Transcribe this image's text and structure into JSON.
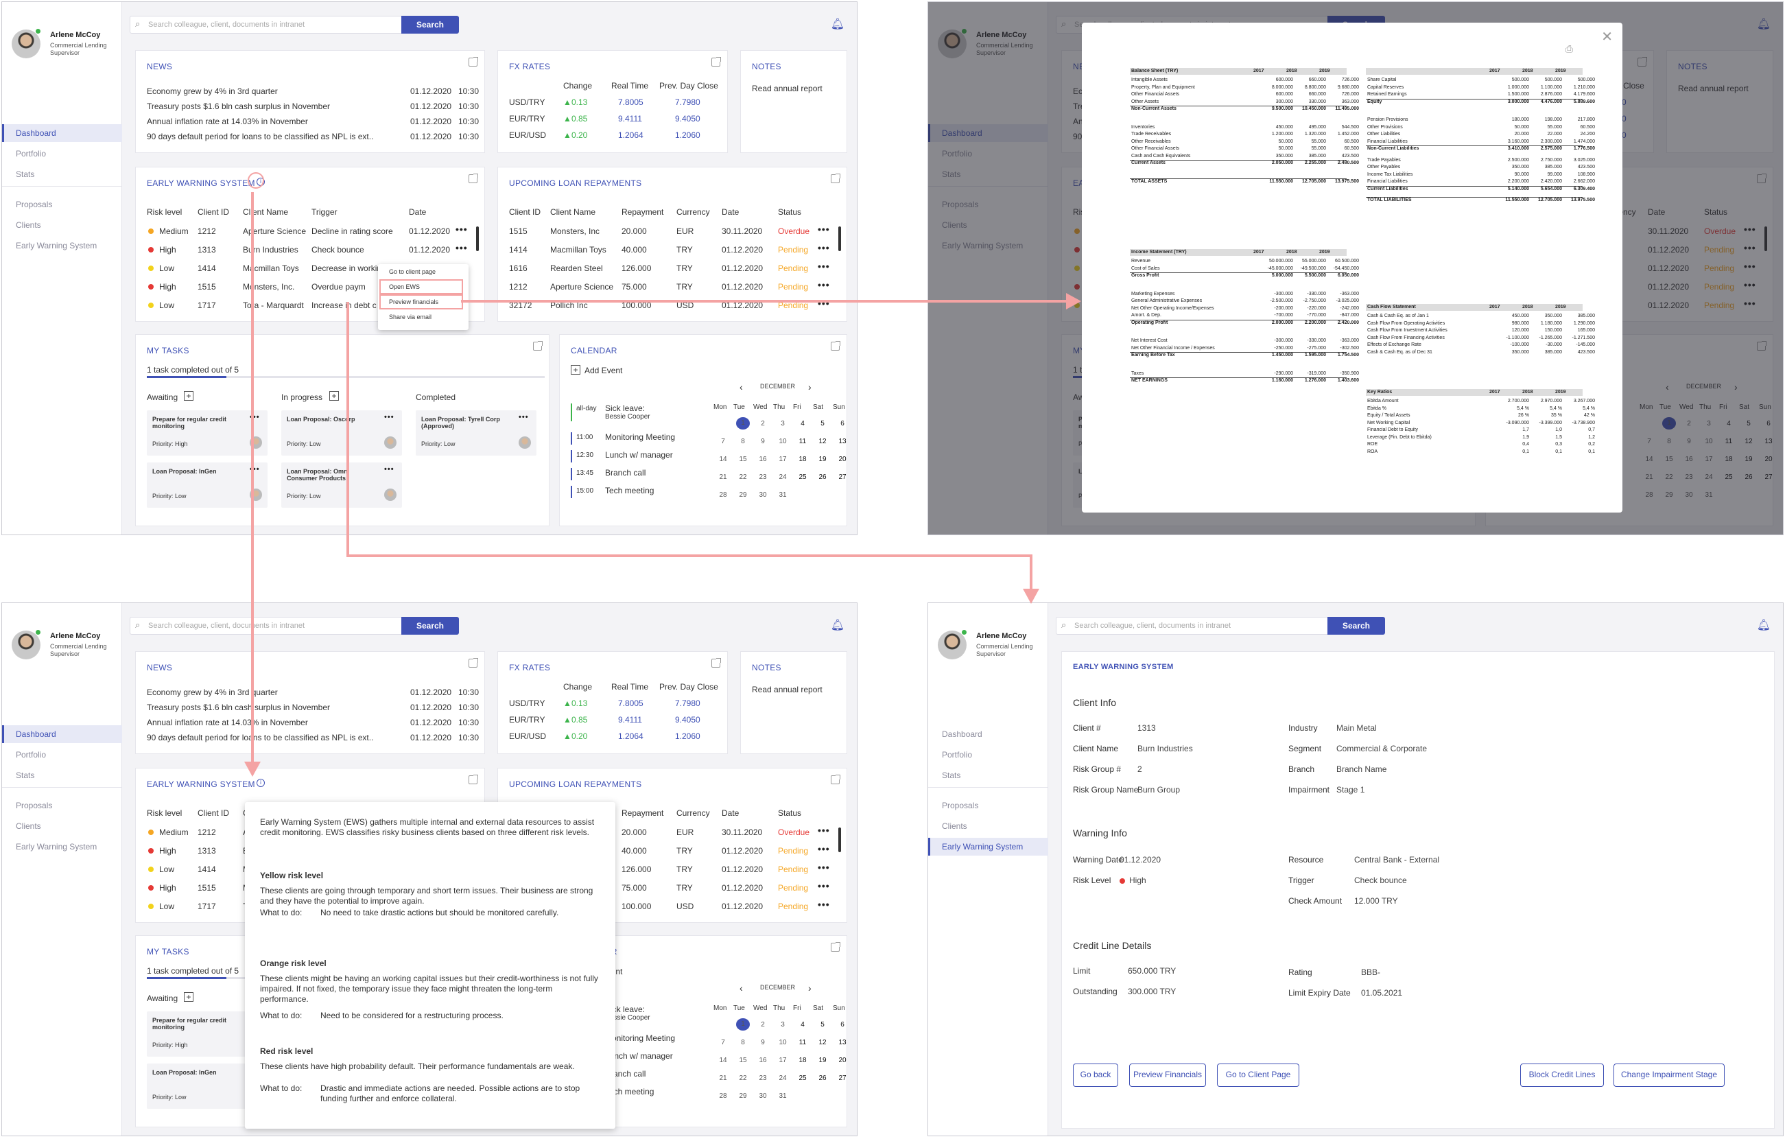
{
  "user": {
    "name": "Arlene McCoy",
    "role1": "Commercial Lending",
    "role2": "Supervisor"
  },
  "nav": {
    "dashboard": "Dashboard",
    "portfolio": "Portfolio",
    "stats": "Stats",
    "proposals": "Proposals",
    "clients": "Clients",
    "ews": "Early Warning System"
  },
  "search": {
    "placeholder": "Search colleague, client, documents in intranet",
    "button": "Search"
  },
  "news": {
    "title": "NEWS",
    "items": [
      {
        "text": "Economy grew by 4% in 3rd quarter",
        "date": "01.12.2020",
        "time": "10:30"
      },
      {
        "text": "Treasury posts $1.6 bln cash surplus in November",
        "date": "01.12.2020",
        "time": "10:30"
      },
      {
        "text": "Annual inflation rate at 14.03% in November",
        "date": "01.12.2020",
        "time": "10:30"
      },
      {
        "text": "90 days default period for loans to be classified as NPL is ext...",
        "date": "01.12.2020",
        "time": "10:30"
      }
    ]
  },
  "fx": {
    "title": "FX RATES",
    "headers": [
      "Change",
      "Real Time",
      "Prev. Day Close"
    ],
    "rows": [
      {
        "pair": "USD/TRY",
        "change": "0.13",
        "rt": "7.8005",
        "prev": "7.7980"
      },
      {
        "pair": "EUR/TRY",
        "change": "0.85",
        "rt": "9.4111",
        "prev": "9.4050"
      },
      {
        "pair": "EUR/USD",
        "change": "0.20",
        "rt": "1.2064",
        "prev": "1.2060"
      }
    ]
  },
  "notes": {
    "title": "NOTES",
    "text": "Read annual report"
  },
  "ews": {
    "title": "EARLY WARNING SYSTEM",
    "headers": [
      "Risk level",
      "Client ID",
      "Client Name",
      "Trigger",
      "Date"
    ],
    "rows": [
      {
        "risk": "Medium",
        "color": "#f5a623",
        "id": "1212",
        "name": "Aperture Science",
        "trigger": "Decline in rating score",
        "date": "01.12.2020"
      },
      {
        "risk": "High",
        "color": "#e53935",
        "id": "1313",
        "name": "Burn Industries",
        "trigger": "Check bounce",
        "date": "01.12.2020"
      },
      {
        "risk": "Low",
        "color": "#f2d21b",
        "id": "1414",
        "name": "Macmillan Toys",
        "trigger": "Decrease in workin",
        "date": ""
      },
      {
        "risk": "High",
        "color": "#e53935",
        "id": "1515",
        "name": "Monsters, Inc.",
        "trigger": "Overdue paym",
        "date": ""
      },
      {
        "risk": "Low",
        "color": "#f2d21b",
        "id": "1717",
        "name": "Tora - Marquardt",
        "trigger": "Increase in debt c",
        "date": ""
      }
    ],
    "menu": [
      "Go to client page",
      "Open EWS",
      "Preview financials",
      "Share via email"
    ]
  },
  "loans": {
    "title": "UPCOMING LOAN REPAYMENTS",
    "headers": [
      "Client ID",
      "Client Name",
      "Repayment",
      "Currency",
      "Date",
      "Status"
    ],
    "rows": [
      {
        "id": "1515",
        "name": "Monsters, Inc",
        "amt": "20.000",
        "cur": "EUR",
        "date": "30.11.2020",
        "status": "Overdue"
      },
      {
        "id": "1414",
        "name": "Macmillan Toys",
        "amt": "40.000",
        "cur": "TRY",
        "date": "01.12.2020",
        "status": "Pending"
      },
      {
        "id": "1616",
        "name": "Rearden Steel",
        "amt": "126.000",
        "cur": "TRY",
        "date": "01.12.2020",
        "status": "Pending"
      },
      {
        "id": "1212",
        "name": "Aperture Science",
        "amt": "75.000",
        "cur": "TRY",
        "date": "01.12.2020",
        "status": "Pending"
      },
      {
        "id": "32172",
        "name": "Pollich Inc",
        "amt": "100.000",
        "cur": "USD",
        "date": "01.12.2020",
        "status": "Pending"
      }
    ]
  },
  "tasks": {
    "title": "MY TASKS",
    "progress": "1 task completed out of 5",
    "cols": [
      "Awaiting",
      "In progress",
      "Completed"
    ],
    "cards": [
      {
        "title": "Prepare for regular credit monitoring",
        "prio": "Priority: High"
      },
      {
        "title": "Loan Proposal: InGen",
        "prio": "Priority: Low"
      },
      {
        "title": "Loan Proposal: Oscorp",
        "prio": "Priority: Low"
      },
      {
        "title": "Loan Proposal: Omni Consumer Products",
        "prio": "Priority: Low"
      },
      {
        "title": "Loan Proposal: Tyrell Corp (Approved)",
        "prio": "Priority: Low"
      }
    ]
  },
  "calendar": {
    "title": "CALENDAR",
    "add": "Add Event",
    "month": "DECEMBER",
    "events": [
      {
        "time": "all-day",
        "title": "Sick leave:",
        "sub": "Bessie Cooper"
      },
      {
        "time": "11:00",
        "title": "Monitoring Meeting"
      },
      {
        "time": "12:30",
        "title": "Lunch w/ manager"
      },
      {
        "time": "13:45",
        "title": "Branch call"
      },
      {
        "time": "15:00",
        "title": "Tech meeting"
      }
    ],
    "days": [
      "Mon",
      "Tue",
      "Wed",
      "Thu",
      "Fri",
      "Sat",
      "Sun"
    ],
    "weeks": [
      [
        "",
        "1",
        "2",
        "3",
        "4",
        "5",
        "6"
      ],
      [
        "7",
        "8",
        "9",
        "10",
        "11",
        "12",
        "13"
      ],
      [
        "14",
        "15",
        "16",
        "17",
        "18",
        "19",
        "20"
      ],
      [
        "21",
        "22",
        "23",
        "24",
        "25",
        "26",
        "27"
      ],
      [
        "28",
        "29",
        "30",
        "31",
        "",
        "",
        ""
      ]
    ]
  },
  "popover": {
    "intro": "Early Warning System (EWS) gathers multiple internal and external data resources to assist credit monitoring. EWS classifies risky business clients based on three different risk levels.",
    "levels": [
      {
        "name": "Yellow risk level",
        "desc": "These clients are going through temporary and short term issues. Their business are strong and they have the potential to improve again.",
        "todo_label": "What to do:",
        "todo": "No need to take drastic actions but should be monitored carefully."
      },
      {
        "name": "Orange risk level",
        "desc": "These clients might be having an working capital issues but their credit-worthiness is not fully impaired. If not fixed, the temporary issue they face might threaten the long-term performance.",
        "todo_label": "What to do:",
        "todo": "Need to be considered for a restructuring process."
      },
      {
        "name": "Red risk level",
        "desc": "These clients have high probability default. Their performance fundamentals are weak.",
        "todo_label": "What to do:",
        "todo": "Drastic and immediate actions are needed. Possible actions are to stop funding further and enforce collateral."
      }
    ]
  },
  "detail": {
    "title": "EARLY WARNING SYSTEM",
    "client_info": "Client Info",
    "client_no_l": "Client #",
    "client_no": "1313",
    "client_name_l": "Client Name",
    "client_name": "Burn Industries",
    "rg_l": "Risk Group #",
    "rg": "2",
    "rgn_l": "Risk Group Name",
    "rgn": "Burn Group",
    "industry_l": "Industry",
    "industry": "Main Metal",
    "segment_l": "Segment",
    "segment": "Commercial & Corporate",
    "branch_l": "Branch",
    "branch": "Branch Name",
    "imp_l": "Impairment",
    "imp": "Stage 1",
    "warning_info": "Warning Info",
    "wdate_l": "Warning Date",
    "wdate": "01.12.2020",
    "rlevel_l": "Risk Level",
    "rlevel": "High",
    "res_l": "Resource",
    "res": "Central Bank - External",
    "trig_l": "Trigger",
    "trig": "Check bounce",
    "camt_l": "Check Amount",
    "camt": "12.000 TRY",
    "credit": "Credit Line Details",
    "limit_l": "Limit",
    "limit": "650.000 TRY",
    "out_l": "Outstanding",
    "out": "300.000 TRY",
    "rating_l": "Rating",
    "rating": "BBB-",
    "exp_l": "Limit Expiry Date",
    "exp": "01.05.2021",
    "buttons": [
      "Go back",
      "Preview Financials",
      "Go to Client Page",
      "Block Credit Lines",
      "Change Impairment Stage"
    ]
  },
  "fin": {
    "bs_title": "Balance Sheet (TRY)",
    "years": [
      "2017",
      "2018",
      "2019"
    ],
    "bs_assets": [
      [
        "Intangible Assets",
        "600.000",
        "660.000",
        "726.000"
      ],
      [
        "Property, Plan and Equipment",
        "8.000.000",
        "8.800.000",
        "9.680.000"
      ],
      [
        "Other Financial Assets",
        "600.000",
        "660.000",
        "726.000"
      ],
      [
        "Other Assets",
        "300.000",
        "330.000",
        "363.000"
      ]
    ],
    "nca": [
      "Non-Current Assets",
      "9.500.000",
      "10.450.000",
      "11.495.000"
    ],
    "bs_current": [
      [
        "Inventories",
        "450.000",
        "495.000",
        "544.500"
      ],
      [
        "Trade Receivables",
        "1.200.000",
        "1.320.000",
        "1.452.000"
      ],
      [
        "Other Receivables",
        "50.000",
        "55.000",
        "60.500"
      ],
      [
        "Other Financial Assets",
        "50.000",
        "55.000",
        "60.500"
      ],
      [
        "Cash and Cash Equivalents",
        "350.000",
        "385.000",
        "423.500"
      ]
    ],
    "ca": [
      "Current Assets",
      "2.050.000",
      "2.255.000",
      "2.480.500"
    ],
    "ta": [
      "TOTAL ASSETS",
      "11.550.000",
      "12.705.000",
      "13.975.500"
    ],
    "eq_rows": [
      [
        "Share Capital",
        "500.000",
        "500.000",
        "500.000"
      ],
      [
        "Capital Reserves",
        "1.000.000",
        "1.100.000",
        "1.210.000"
      ],
      [
        "Retained Earnings",
        "1.500.000",
        "2.876.000",
        "4.179.600"
      ]
    ],
    "equity": [
      "Equity",
      "3.000.000",
      "4.476.000",
      "5.889.600"
    ],
    "ncl_rows": [
      [
        "Pension Provisions",
        "180.000",
        "198.000",
        "217.800"
      ],
      [
        "Other Provisions",
        "50.000",
        "55.000",
        "60.500"
      ],
      [
        "Other Liabilities",
        "20.000",
        "22.000",
        "24.200"
      ],
      [
        "Financial Liabilities",
        "3.160.000",
        "2.300.000",
        "1.474.000"
      ]
    ],
    "ncl": [
      "Non-Current Liabilities",
      "3.410.000",
      "2.575.000",
      "1.776.500"
    ],
    "cl_rows": [
      [
        "Trade Payables",
        "2.500.000",
        "2.750.000",
        "3.025.000"
      ],
      [
        "Other Payables",
        "350.000",
        "385.000",
        "423.500"
      ],
      [
        "Income Tax Liabilities",
        "90.000",
        "99.000",
        "108.900"
      ],
      [
        "Financial Liabilities",
        "2.200.000",
        "2.420.000",
        "2.662.000"
      ]
    ],
    "cl": [
      "Current Liabilities",
      "5.140.000",
      "5.654.000",
      "6.309.400"
    ],
    "tl": [
      "TOTAL LIABILITIES",
      "11.550.000",
      "12.705.000",
      "13.975.500"
    ],
    "is_title": "Income Statement (TRY)",
    "is_rows": [
      [
        "Revenue",
        "50.000.000",
        "55.000.000",
        "60.500.000"
      ],
      [
        "Cost of Sales",
        "-45.000.000",
        "-49.500.000",
        "-54.450.000"
      ]
    ],
    "gp": [
      "Gross Profit",
      "5.000.000",
      "5.500.000",
      "6.050.000"
    ],
    "op_rows": [
      [
        "Marketing Expenses",
        "-300.000",
        "-330.000",
        "-363.000"
      ],
      [
        "General Administrative Expenses",
        "-2.500.000",
        "-2.750.000",
        "-3.025.000"
      ],
      [
        "Net Other Operating Income/Expenses",
        "-200.000",
        "-220.000",
        "-242.000"
      ],
      [
        "Amort. & Dep.",
        "-700.000",
        "-770.000",
        "-847.000"
      ]
    ],
    "op": [
      "Operating Profit",
      "2.000.000",
      "2.200.000",
      "2.420.000"
    ],
    "int_rows": [
      [
        "Net Interest Cost",
        "-300.000",
        "-330.000",
        "-363.000"
      ],
      [
        "Net Other Financial Income / Expenses",
        "-250.000",
        "-275.000",
        "-302.500"
      ]
    ],
    "ebt": [
      "Earning Before Tax",
      "1.450.000",
      "1.595.000",
      "1.754.500"
    ],
    "tax": [
      "Taxes",
      "-290.000",
      "-319.000",
      "-350.900"
    ],
    "ne": [
      "NET EARNINGS",
      "1.160.000",
      "1.276.000",
      "1.403.600"
    ],
    "cf_title": "Cash Flow Statement",
    "cf_rows": [
      [
        "Cash & Cash Eq. as of Jan 1",
        "450.000",
        "350.000",
        "385.000"
      ],
      [
        "Cash Flow From Operating Activities",
        "980.000",
        "1.180.000",
        "1.290.000"
      ],
      [
        "Cash Flow From Investment Activities",
        "120.000",
        "150.000",
        "165.000"
      ],
      [
        "Cash Flow From Financing Activities",
        "-1.100.000",
        "-1.265.000",
        "-1.271.500"
      ],
      [
        "Effects of Exchange Rate",
        "-100.000",
        "-30.000",
        "-145.000"
      ],
      [
        "Cash & Cash Eq. as of Dec 31",
        "350.000",
        "385.000",
        "423.500"
      ]
    ],
    "kr_title": "Key Ratios",
    "kr_rows": [
      [
        "Ebitda Amount",
        "2.700.000",
        "2.970.000",
        "3.267.000"
      ],
      [
        "Ebitda %",
        "5,4 %",
        "5,4 %",
        "5,4 %"
      ],
      [
        "Equity / Total Assets",
        "26 %",
        "35 %",
        "42 %"
      ],
      [
        "Net Working Capital",
        "-3.090.000",
        "-3.399.000",
        "-3.738.900"
      ],
      [
        "Financial Debt to Equity",
        "1,7",
        "1,0",
        "0,7"
      ],
      [
        "Leverage (Fin. Debt to Ebitda)",
        "1,9",
        "1,5",
        "1,2"
      ],
      [
        "ROE",
        "0,4",
        "0,3",
        "0,2"
      ],
      [
        "ROA",
        "0,1",
        "0,1",
        "0,1"
      ]
    ]
  }
}
